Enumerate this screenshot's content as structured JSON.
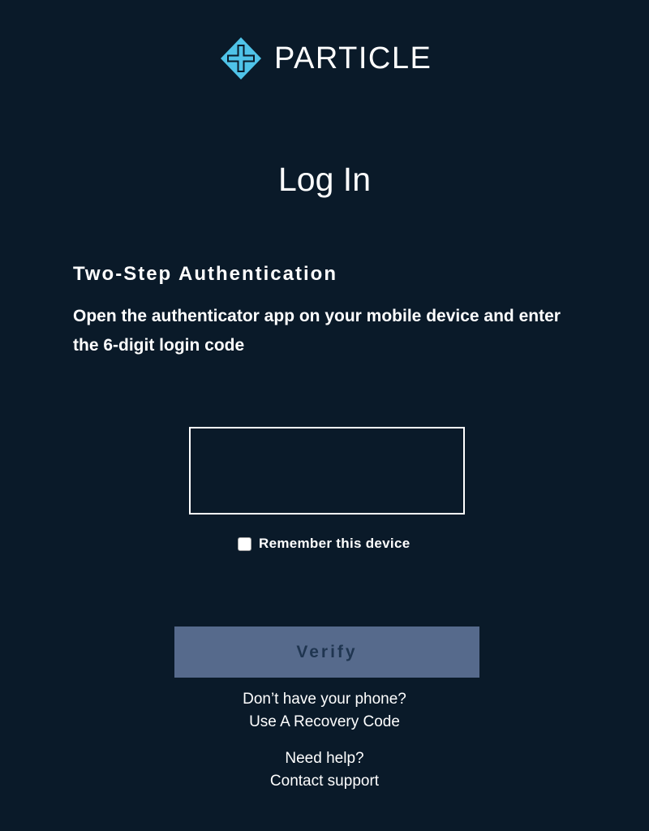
{
  "brand": {
    "name": "PARTICLE",
    "logo_icon": "particle-logo-icon",
    "logo_color": "#4fc3e8"
  },
  "page": {
    "title": "Log In",
    "background_color": "#0a1a29"
  },
  "two_step": {
    "heading": "Two-Step Authentication",
    "instructions": "Open the authenticator app on your mobile device and enter the 6-digit login code",
    "code_input": {
      "value": "",
      "placeholder": ""
    },
    "remember_device": {
      "label": "Remember this device",
      "checked": false
    },
    "verify_label": "Verify",
    "verify_color": "#566a8c"
  },
  "recovery": {
    "prompt": "Don’t have your phone?",
    "link": "Use A Recovery Code"
  },
  "support": {
    "prompt": "Need help?",
    "link": "Contact support"
  }
}
